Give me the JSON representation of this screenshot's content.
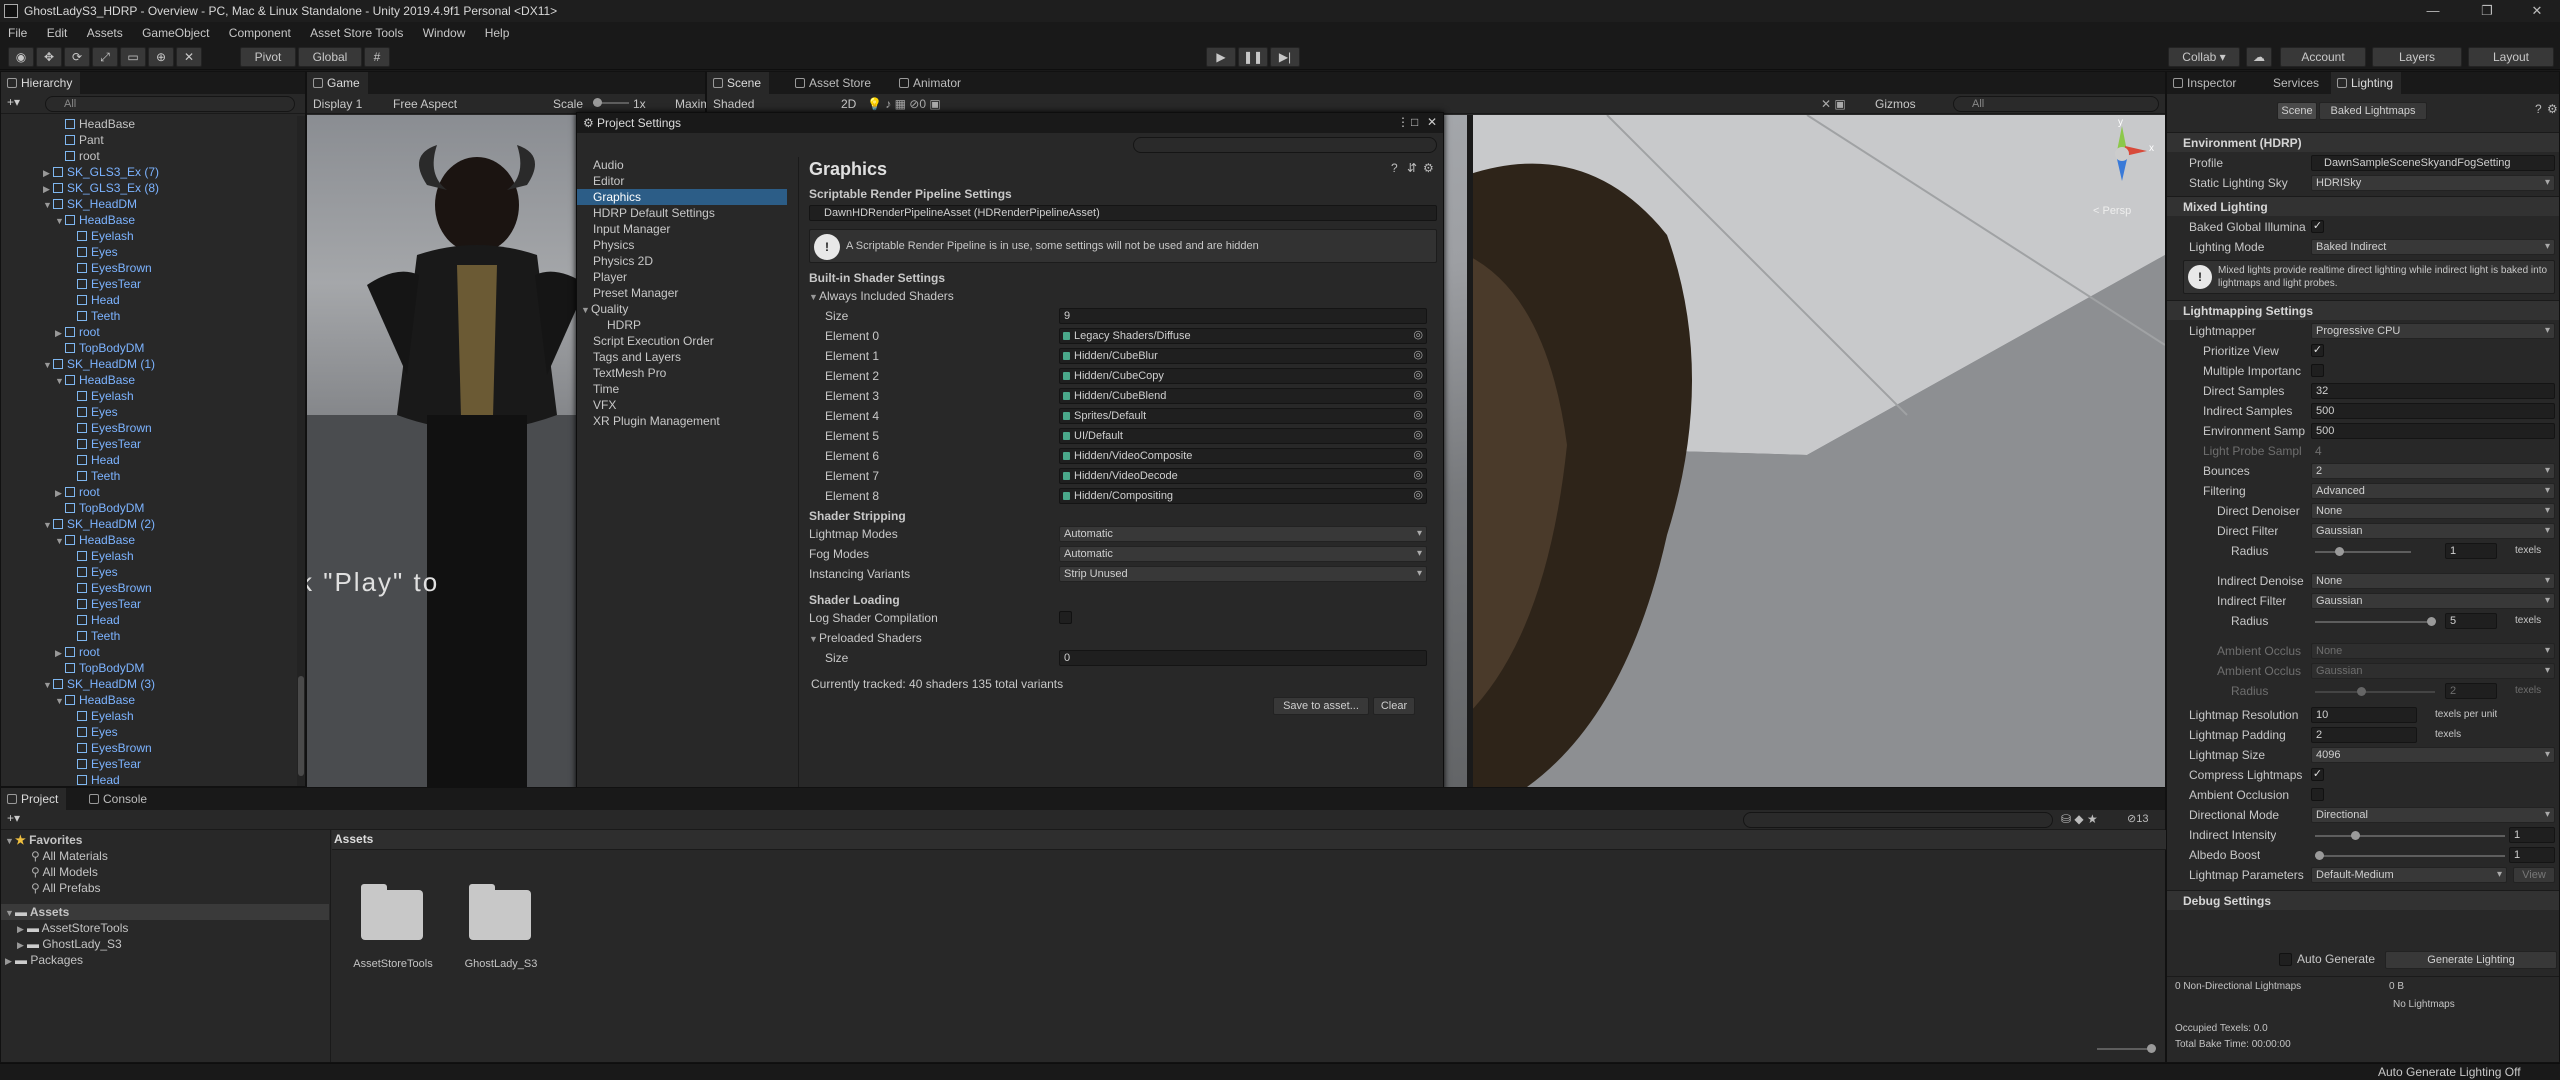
{
  "window": {
    "title": "GhostLadyS3_HDRP - Overview - PC, Mac & Linux Standalone - Unity 2019.4.9f1 Personal <DX11>"
  },
  "menu": [
    "File",
    "Edit",
    "Assets",
    "GameObject",
    "Component",
    "Asset Store Tools",
    "Window",
    "Help"
  ],
  "toolbar": {
    "pivot": "Pivot",
    "global": "Global",
    "collab": "Collab ▾",
    "account": "Account",
    "layers": "Layers",
    "layout": "Layout"
  },
  "hierarchy": {
    "tab": "Hierarchy",
    "search_placeholder": "All",
    "rows": [
      {
        "t": "HeadBase",
        "d": 3,
        "i": true,
        "b": false,
        "a": ""
      },
      {
        "t": "Pant",
        "d": 3,
        "i": true,
        "b": false,
        "a": ""
      },
      {
        "t": "root",
        "d": 3,
        "i": true,
        "b": false,
        "a": ""
      },
      {
        "t": "SK_GLS3_Ex (7)",
        "d": 2,
        "i": true,
        "b": true,
        "a": "▶"
      },
      {
        "t": "SK_GLS3_Ex (8)",
        "d": 2,
        "i": true,
        "b": true,
        "a": "▶"
      },
      {
        "t": "SK_HeadDM",
        "d": 2,
        "i": true,
        "b": true,
        "a": "▼"
      },
      {
        "t": "HeadBase",
        "d": 3,
        "i": true,
        "b": true,
        "a": "▼"
      },
      {
        "t": "Eyelash",
        "d": 4,
        "i": true,
        "b": true,
        "a": ""
      },
      {
        "t": "Eyes",
        "d": 4,
        "i": true,
        "b": true,
        "a": ""
      },
      {
        "t": "EyesBrown",
        "d": 4,
        "i": true,
        "b": true,
        "a": ""
      },
      {
        "t": "EyesTear",
        "d": 4,
        "i": true,
        "b": true,
        "a": ""
      },
      {
        "t": "Head",
        "d": 4,
        "i": true,
        "b": true,
        "a": ""
      },
      {
        "t": "Teeth",
        "d": 4,
        "i": true,
        "b": true,
        "a": ""
      },
      {
        "t": "root",
        "d": 3,
        "i": true,
        "b": true,
        "a": "▶"
      },
      {
        "t": "TopBodyDM",
        "d": 3,
        "i": true,
        "b": true,
        "a": ""
      },
      {
        "t": "SK_HeadDM (1)",
        "d": 2,
        "i": true,
        "b": true,
        "a": "▼"
      },
      {
        "t": "HeadBase",
        "d": 3,
        "i": true,
        "b": true,
        "a": "▼"
      },
      {
        "t": "Eyelash",
        "d": 4,
        "i": true,
        "b": true,
        "a": ""
      },
      {
        "t": "Eyes",
        "d": 4,
        "i": true,
        "b": true,
        "a": ""
      },
      {
        "t": "EyesBrown",
        "d": 4,
        "i": true,
        "b": true,
        "a": ""
      },
      {
        "t": "EyesTear",
        "d": 4,
        "i": true,
        "b": true,
        "a": ""
      },
      {
        "t": "Head",
        "d": 4,
        "i": true,
        "b": true,
        "a": ""
      },
      {
        "t": "Teeth",
        "d": 4,
        "i": true,
        "b": true,
        "a": ""
      },
      {
        "t": "root",
        "d": 3,
        "i": true,
        "b": true,
        "a": "▶"
      },
      {
        "t": "TopBodyDM",
        "d": 3,
        "i": true,
        "b": true,
        "a": ""
      },
      {
        "t": "SK_HeadDM (2)",
        "d": 2,
        "i": true,
        "b": true,
        "a": "▼"
      },
      {
        "t": "HeadBase",
        "d": 3,
        "i": true,
        "b": true,
        "a": "▼"
      },
      {
        "t": "Eyelash",
        "d": 4,
        "i": true,
        "b": true,
        "a": ""
      },
      {
        "t": "Eyes",
        "d": 4,
        "i": true,
        "b": true,
        "a": ""
      },
      {
        "t": "EyesBrown",
        "d": 4,
        "i": true,
        "b": true,
        "a": ""
      },
      {
        "t": "EyesTear",
        "d": 4,
        "i": true,
        "b": true,
        "a": ""
      },
      {
        "t": "Head",
        "d": 4,
        "i": true,
        "b": true,
        "a": ""
      },
      {
        "t": "Teeth",
        "d": 4,
        "i": true,
        "b": true,
        "a": ""
      },
      {
        "t": "root",
        "d": 3,
        "i": true,
        "b": true,
        "a": "▶"
      },
      {
        "t": "TopBodyDM",
        "d": 3,
        "i": true,
        "b": true,
        "a": ""
      },
      {
        "t": "SK_HeadDM (3)",
        "d": 2,
        "i": true,
        "b": true,
        "a": "▼"
      },
      {
        "t": "HeadBase",
        "d": 3,
        "i": true,
        "b": true,
        "a": "▼"
      },
      {
        "t": "Eyelash",
        "d": 4,
        "i": true,
        "b": true,
        "a": ""
      },
      {
        "t": "Eyes",
        "d": 4,
        "i": true,
        "b": true,
        "a": ""
      },
      {
        "t": "EyesBrown",
        "d": 4,
        "i": true,
        "b": true,
        "a": ""
      },
      {
        "t": "EyesTear",
        "d": 4,
        "i": true,
        "b": true,
        "a": ""
      },
      {
        "t": "Head",
        "d": 4,
        "i": true,
        "b": true,
        "a": ""
      }
    ]
  },
  "game": {
    "tab": "Game",
    "display": "Display 1",
    "aspect": "Free Aspect",
    "scale_label": "Scale",
    "scale_value": "1x",
    "maxim": "Maxim",
    "overlay_text": "k \"Play\" to"
  },
  "scene": {
    "tabs": [
      "Scene",
      "Asset Store",
      "Animator"
    ],
    "shading": "Shaded",
    "mode2d": "2D",
    "gizmos": "Gizmos",
    "search_placeholder": "All",
    "persp": "< Persp",
    "axis_y": "y",
    "axis_x": "x"
  },
  "project_settings": {
    "title": "Project Settings",
    "categories": [
      "Audio",
      "Editor",
      "Graphics",
      "HDRP Default Settings",
      "Input Manager",
      "Physics",
      "Physics 2D",
      "Player",
      "Preset Manager",
      "Quality",
      "HDRP",
      "Script Execution Order",
      "Tags and Layers",
      "TextMesh Pro",
      "Time",
      "VFX",
      "XR Plugin Management"
    ],
    "heading": "Graphics",
    "srp_section": "Scriptable Render Pipeline Settings",
    "srp_asset": "DawnHDRenderPipelineAsset (HDRenderPipelineAsset)",
    "warning": "A Scriptable Render Pipeline is in use, some settings will not be used and are hidden",
    "builtin_section": "Built-in Shader Settings",
    "always_included": "Always Included Shaders",
    "size_label": "Size",
    "size_value": "9",
    "elements": [
      {
        "label": "Element 0",
        "value": "Legacy Shaders/Diffuse"
      },
      {
        "label": "Element 1",
        "value": "Hidden/CubeBlur"
      },
      {
        "label": "Element 2",
        "value": "Hidden/CubeCopy"
      },
      {
        "label": "Element 3",
        "value": "Hidden/CubeBlend"
      },
      {
        "label": "Element 4",
        "value": "Sprites/Default"
      },
      {
        "label": "Element 5",
        "value": "UI/Default"
      },
      {
        "label": "Element 6",
        "value": "Hidden/VideoComposite"
      },
      {
        "label": "Element 7",
        "value": "Hidden/VideoDecode"
      },
      {
        "label": "Element 8",
        "value": "Hidden/Compositing"
      }
    ],
    "stripping_section": "Shader Stripping",
    "lightmap_modes_label": "Lightmap Modes",
    "lightmap_modes": "Automatic",
    "fog_modes_label": "Fog Modes",
    "fog_modes": "Automatic",
    "instancing_label": "Instancing Variants",
    "instancing": "Strip Unused",
    "loading_section": "Shader Loading",
    "log_label": "Log Shader Compilation",
    "preloaded": "Preloaded Shaders",
    "pre_size_label": "Size",
    "pre_size": "0",
    "tracked": "Currently tracked: 40 shaders 135 total variants",
    "save_btn": "Save to asset...",
    "clear_btn": "Clear"
  },
  "project": {
    "tabs": [
      "Project",
      "Console"
    ],
    "favorites": "Favorites",
    "fav_items": [
      "All Materials",
      "All Models",
      "All Prefabs"
    ],
    "assets": "Assets",
    "asset_items": [
      "AssetStoreTools",
      "GhostLady_S3"
    ],
    "packages": "Packages",
    "breadcrumb": "Assets",
    "folders": [
      "AssetStoreTools",
      "GhostLady_S3"
    ],
    "count": "13"
  },
  "inspector": {
    "tabs": [
      "Inspector",
      "Services",
      "Lighting"
    ],
    "sub_tabs": [
      "Scene",
      "Baked Lightmaps"
    ],
    "env_section": "Environment (HDRP)",
    "profile_label": "Profile",
    "profile_value": "DawnSampleSceneSkyandFogSetting",
    "static_sky_label": "Static Lighting Sky",
    "static_sky_value": "HDRISky",
    "mixed_section": "Mixed Lighting",
    "baked_gi_label": "Baked Global Illumina",
    "lighting_mode_label": "Lighting Mode",
    "lighting_mode_value": "Baked Indirect",
    "mixed_note": "Mixed lights provide realtime direct lighting while indirect light is baked into lightmaps and light probes.",
    "lm_section": "Lightmapping Settings",
    "lightmapper_label": "Lightmapper",
    "lightmapper_value": "Progressive CPU",
    "prioritize_label": "Prioritize View",
    "multiple_label": "Multiple Importanc",
    "direct_samples_label": "Direct Samples",
    "direct_samples": "32",
    "indirect_samples_label": "Indirect Samples",
    "indirect_samples": "500",
    "env_samples_label": "Environment Samp",
    "env_samples": "500",
    "probe_label": "Light Probe Sampl",
    "probe_value": "4",
    "bounces_label": "Bounces",
    "bounces": "2",
    "filtering_label": "Filtering",
    "filtering": "Advanced",
    "direct_denoiser_label": "Direct Denoiser",
    "direct_denoiser": "None",
    "direct_filter_label": "Direct Filter",
    "direct_filter": "Gaussian",
    "radius_label": "Radius",
    "radius1": "1",
    "texels": "texels",
    "indirect_denoiser_label": "Indirect Denoise",
    "indirect_denoiser": "None",
    "indirect_filter_label": "Indirect Filter",
    "indirect_filter": "Gaussian",
    "radius2": "5",
    "ao_denoise_label": "Ambient Occlus",
    "ao_denoise": "None",
    "ao_filter_label": "Ambient Occlus",
    "ao_filter": "Gaussian",
    "radius3": "2",
    "lm_res_label": "Lightmap Resolution",
    "lm_res": "10",
    "texels_per_unit": "texels per unit",
    "lm_pad_label": "Lightmap Padding",
    "lm_pad": "2",
    "lm_size_label": "Lightmap Size",
    "lm_size": "4096",
    "compress_label": "Compress Lightmaps",
    "ao_label": "Ambient Occlusion",
    "dir_mode_label": "Directional Mode",
    "dir_mode": "Directional",
    "indirect_int_label": "Indirect Intensity",
    "indirect_int": "1",
    "albedo_label": "Albedo Boost",
    "albedo": "1",
    "lm_params_label": "Lightmap Parameters",
    "lm_params": "Default-Medium",
    "view_btn": "View",
    "debug_section": "Debug Settings",
    "auto_generate": "Auto Generate",
    "generate_btn": "Generate Lighting",
    "stats_lm": "0 Non-Directional Lightmaps",
    "stats_size": "0 B",
    "stats_none": "No Lightmaps",
    "occupied": "Occupied Texels: 0.0",
    "bake_time": "Total Bake Time: 00:00:00"
  },
  "status": {
    "right": "Auto Generate Lighting Off"
  }
}
